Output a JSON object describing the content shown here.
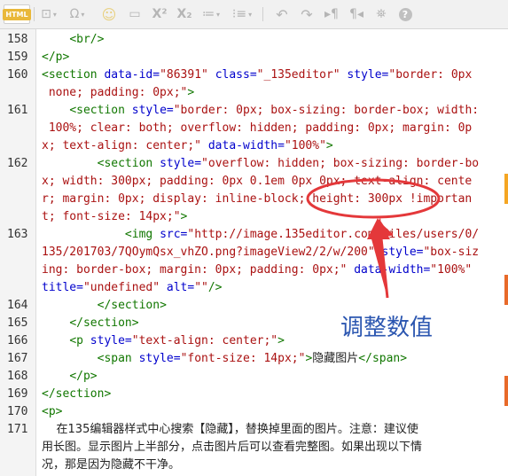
{
  "toolbar": {
    "html_label": "HTML",
    "buttons": [
      {
        "icon": "html-icon",
        "glyph": "HTML"
      },
      {
        "icon": "special-char-icon",
        "glyph": "Ω"
      },
      {
        "icon": "emoji-icon",
        "glyph": "☺"
      },
      {
        "icon": "link-icon",
        "glyph": "▭"
      },
      {
        "icon": "superscript-icon",
        "glyph": "X²"
      },
      {
        "icon": "subscript-icon",
        "glyph": "X₂"
      },
      {
        "icon": "ordered-list-icon",
        "glyph": "1≡"
      },
      {
        "icon": "unordered-list-icon",
        "glyph": "•≡"
      },
      {
        "icon": "undo-icon",
        "glyph": "↶"
      },
      {
        "icon": "redo-icon",
        "glyph": "↷"
      },
      {
        "icon": "ltr-icon",
        "glyph": "¶"
      },
      {
        "icon": "rtl-icon",
        "glyph": "¶"
      },
      {
        "icon": "binoculars-icon",
        "glyph": "⛯"
      },
      {
        "icon": "help-icon",
        "glyph": "?"
      }
    ]
  },
  "lines": [
    {
      "n": "158",
      "rows": [
        [
          [
            "t",
            "    "
          ],
          [
            "tag",
            "<br/>"
          ]
        ]
      ]
    },
    {
      "n": "159",
      "rows": [
        [
          [
            "tag",
            "</p>"
          ]
        ]
      ]
    },
    {
      "n": "160",
      "rows": [
        [
          [
            "tag",
            "<section "
          ],
          [
            "attr",
            "data-id="
          ],
          [
            "str",
            "\"86391\""
          ],
          [
            "attr",
            " class="
          ],
          [
            "str",
            "\"_135editor\""
          ],
          [
            "attr",
            " style="
          ],
          [
            "str",
            "\"border: 0px"
          ]
        ],
        [
          [
            "str",
            " none; padding: 0px;\""
          ],
          [
            "tag",
            ">"
          ]
        ]
      ]
    },
    {
      "n": "161",
      "rows": [
        [
          [
            "t",
            "    "
          ],
          [
            "tag",
            "<section "
          ],
          [
            "attr",
            "style="
          ],
          [
            "str",
            "\"border: 0px; box-sizing: border-box; width:"
          ]
        ],
        [
          [
            "str",
            " 100%; clear: both; overflow: hidden; padding: 0px; margin: 0p"
          ]
        ],
        [
          [
            "str",
            "x; text-align: center;\""
          ],
          [
            "attr",
            " data-width="
          ],
          [
            "str",
            "\"100%\""
          ],
          [
            "tag",
            ">"
          ]
        ]
      ]
    },
    {
      "n": "162",
      "rows": [
        [
          [
            "t",
            "        "
          ],
          [
            "tag",
            "<section "
          ],
          [
            "attr",
            "style="
          ],
          [
            "str",
            "\"overflow: hidden; box-sizing: border-bo"
          ]
        ],
        [
          [
            "str",
            "x; width: 300px; padding: 0px 0.1em 0px 0px; text-align: cente"
          ]
        ],
        [
          [
            "str",
            "r; margin: 0px; display: inline-block; height: 300px !importan"
          ]
        ],
        [
          [
            "str",
            "t; font-size: 14px;\""
          ],
          [
            "tag",
            ">"
          ]
        ]
      ]
    },
    {
      "n": "163",
      "rows": [
        [
          [
            "t",
            "            "
          ],
          [
            "tag",
            "<img "
          ],
          [
            "attr",
            "src="
          ],
          [
            "str",
            "\"http://image.135editor.com/files/users/0/"
          ]
        ],
        [
          [
            "str",
            "135/201703/7QOymQsx_vhZO.png?imageView2/2/w/200\""
          ],
          [
            "attr",
            " style="
          ],
          [
            "str",
            "\"box-siz"
          ]
        ],
        [
          [
            "str",
            "ing: border-box; margin: 0px; padding: 0px;\""
          ],
          [
            "attr",
            " data-width="
          ],
          [
            "str",
            "\"100%\""
          ]
        ],
        [
          [
            "attr",
            "title="
          ],
          [
            "str",
            "\"undefined\""
          ],
          [
            "attr",
            " alt="
          ],
          [
            "str",
            "\"\""
          ],
          [
            "tag",
            "/>"
          ]
        ]
      ]
    },
    {
      "n": "164",
      "rows": [
        [
          [
            "t",
            "        "
          ],
          [
            "tag",
            "</section>"
          ]
        ]
      ]
    },
    {
      "n": "165",
      "rows": [
        [
          [
            "t",
            "    "
          ],
          [
            "tag",
            "</section>"
          ]
        ]
      ]
    },
    {
      "n": "166",
      "rows": [
        [
          [
            "t",
            "    "
          ],
          [
            "tag",
            "<p "
          ],
          [
            "attr",
            "style="
          ],
          [
            "str",
            "\"text-align: center;\""
          ],
          [
            "tag",
            ">"
          ]
        ]
      ]
    },
    {
      "n": "167",
      "rows": [
        [
          [
            "t",
            "        "
          ],
          [
            "tag",
            "<span "
          ],
          [
            "attr",
            "style="
          ],
          [
            "str",
            "\"font-size: 14px;\""
          ],
          [
            "tag",
            ">"
          ],
          [
            "cn",
            "隐藏图片"
          ],
          [
            "tag",
            "</span>"
          ]
        ]
      ]
    },
    {
      "n": "168",
      "rows": [
        [
          [
            "t",
            "    "
          ],
          [
            "tag",
            "</p>"
          ]
        ]
      ]
    },
    {
      "n": "169",
      "rows": [
        [
          [
            "tag",
            "</section>"
          ]
        ]
      ]
    },
    {
      "n": "170",
      "rows": [
        [
          [
            "tag",
            "<p>"
          ]
        ]
      ]
    },
    {
      "n": "171",
      "rows": [
        [
          [
            "cn",
            "    在135编辑器样式中心搜索【隐藏】，替换掉里面的图片。注意：建议使"
          ]
        ],
        [
          [
            "cn",
            "用长图。显示图片上半部分，点击图片后可以查看完整图。如果出现以下情"
          ]
        ],
        [
          [
            "cn",
            "况，那是因为隐藏不干净。"
          ]
        ]
      ]
    }
  ],
  "annotation": {
    "label": "调整数值",
    "color": "#e4383a",
    "label_color": "#2b56b0"
  },
  "scroll_marks": {
    "colors": [
      "#f5a623",
      "#e86a2a"
    ]
  }
}
